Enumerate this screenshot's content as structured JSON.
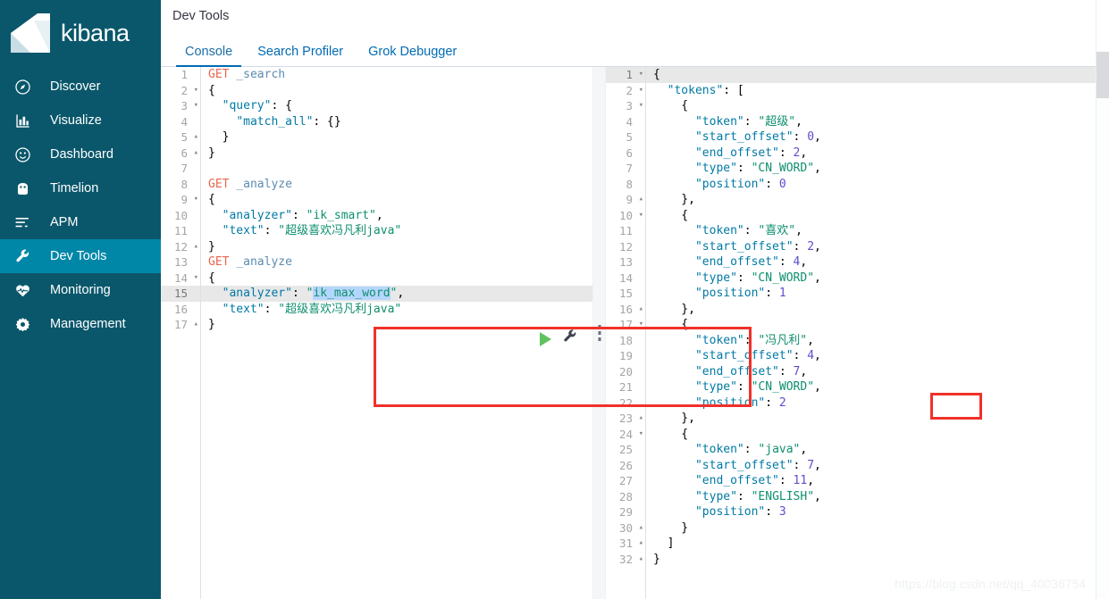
{
  "brand": {
    "name": "kibana",
    "logo_icon": "kibana-logo-icon"
  },
  "sidebar": {
    "items": [
      {
        "label": "Discover",
        "icon": "compass-icon",
        "active": false
      },
      {
        "label": "Visualize",
        "icon": "bar-chart-icon",
        "active": false
      },
      {
        "label": "Dashboard",
        "icon": "dashboard-icon",
        "active": false
      },
      {
        "label": "Timelion",
        "icon": "timelion-icon",
        "active": false
      },
      {
        "label": "APM",
        "icon": "apm-icon",
        "active": false
      },
      {
        "label": "Dev Tools",
        "icon": "wrench-icon",
        "active": true
      },
      {
        "label": "Monitoring",
        "icon": "heartbeat-icon",
        "active": false
      },
      {
        "label": "Management",
        "icon": "gear-icon",
        "active": false
      }
    ]
  },
  "header": {
    "title": "Dev Tools"
  },
  "tabs": [
    {
      "label": "Console",
      "active": true
    },
    {
      "label": "Search Profiler",
      "active": false
    },
    {
      "label": "Grok Debugger",
      "active": false
    }
  ],
  "console": {
    "request_editor": {
      "line_count": 17,
      "current_line": 15,
      "selected_text": "ik_max_word",
      "lines": [
        {
          "n": 1,
          "fold": "",
          "text": "GET _search"
        },
        {
          "n": 2,
          "fold": "v",
          "text": "{"
        },
        {
          "n": 3,
          "fold": "v",
          "text": "  \"query\": {"
        },
        {
          "n": 4,
          "fold": "",
          "text": "    \"match_all\": {}"
        },
        {
          "n": 5,
          "fold": "^",
          "text": "  }"
        },
        {
          "n": 6,
          "fold": "^",
          "text": "}"
        },
        {
          "n": 7,
          "fold": "",
          "text": ""
        },
        {
          "n": 8,
          "fold": "",
          "text": "GET _analyze"
        },
        {
          "n": 9,
          "fold": "v",
          "text": "{"
        },
        {
          "n": 10,
          "fold": "",
          "text": "  \"analyzer\": \"ik_smart\","
        },
        {
          "n": 11,
          "fold": "",
          "text": "  \"text\": \"超级喜欢冯凡利java\""
        },
        {
          "n": 12,
          "fold": "^",
          "text": "}"
        },
        {
          "n": 13,
          "fold": "",
          "text": "GET _analyze"
        },
        {
          "n": 14,
          "fold": "v",
          "text": "{"
        },
        {
          "n": 15,
          "fold": "",
          "text": "  \"analyzer\": \"ik_max_word\","
        },
        {
          "n": 16,
          "fold": "",
          "text": "  \"text\": \"超级喜欢冯凡利java\""
        },
        {
          "n": 17,
          "fold": "^",
          "text": "}"
        }
      ]
    },
    "actions": {
      "run_label": "play-button",
      "wrench_label": "wrench-button"
    },
    "response_editor": {
      "line_count": 32,
      "current_line": 1,
      "lines": [
        {
          "n": 1,
          "fold": "v",
          "text": "{"
        },
        {
          "n": 2,
          "fold": "v",
          "text": "  \"tokens\": ["
        },
        {
          "n": 3,
          "fold": "v",
          "text": "    {"
        },
        {
          "n": 4,
          "fold": "",
          "text": "      \"token\": \"超级\","
        },
        {
          "n": 5,
          "fold": "",
          "text": "      \"start_offset\": 0,"
        },
        {
          "n": 6,
          "fold": "",
          "text": "      \"end_offset\": 2,"
        },
        {
          "n": 7,
          "fold": "",
          "text": "      \"type\": \"CN_WORD\","
        },
        {
          "n": 8,
          "fold": "",
          "text": "      \"position\": 0"
        },
        {
          "n": 9,
          "fold": "^",
          "text": "    },"
        },
        {
          "n": 10,
          "fold": "v",
          "text": "    {"
        },
        {
          "n": 11,
          "fold": "",
          "text": "      \"token\": \"喜欢\","
        },
        {
          "n": 12,
          "fold": "",
          "text": "      \"start_offset\": 2,"
        },
        {
          "n": 13,
          "fold": "",
          "text": "      \"end_offset\": 4,"
        },
        {
          "n": 14,
          "fold": "",
          "text": "      \"type\": \"CN_WORD\","
        },
        {
          "n": 15,
          "fold": "",
          "text": "      \"position\": 1"
        },
        {
          "n": 16,
          "fold": "^",
          "text": "    },"
        },
        {
          "n": 17,
          "fold": "v",
          "text": "    {"
        },
        {
          "n": 18,
          "fold": "",
          "text": "      \"token\": \"冯凡利\","
        },
        {
          "n": 19,
          "fold": "",
          "text": "      \"start_offset\": 4,"
        },
        {
          "n": 20,
          "fold": "",
          "text": "      \"end_offset\": 7,"
        },
        {
          "n": 21,
          "fold": "",
          "text": "      \"type\": \"CN_WORD\","
        },
        {
          "n": 22,
          "fold": "",
          "text": "      \"position\": 2"
        },
        {
          "n": 23,
          "fold": "^",
          "text": "    },"
        },
        {
          "n": 24,
          "fold": "v",
          "text": "    {"
        },
        {
          "n": 25,
          "fold": "",
          "text": "      \"token\": \"java\","
        },
        {
          "n": 26,
          "fold": "",
          "text": "      \"start_offset\": 7,"
        },
        {
          "n": 27,
          "fold": "",
          "text": "      \"end_offset\": 11,"
        },
        {
          "n": 28,
          "fold": "",
          "text": "      \"type\": \"ENGLISH\","
        },
        {
          "n": 29,
          "fold": "",
          "text": "      \"position\": 3"
        },
        {
          "n": 30,
          "fold": "^",
          "text": "    }"
        },
        {
          "n": 31,
          "fold": "^",
          "text": "  ]"
        },
        {
          "n": 32,
          "fold": "^",
          "text": "}"
        }
      ]
    }
  },
  "annotations": {
    "request_highlight_label": "red-highlight-request-block",
    "response_highlight_label": "red-highlight-token-value",
    "highlighted_token": "冯凡利"
  },
  "watermark": {
    "text": "https://blog.csdn.net/qq_40036754"
  },
  "colors": {
    "sidebar_bg": "#0a576b",
    "sidebar_active": "#0087a8",
    "accent": "#006bb4",
    "annotation_red": "#f0312a",
    "run_green": "#5fc25f"
  }
}
